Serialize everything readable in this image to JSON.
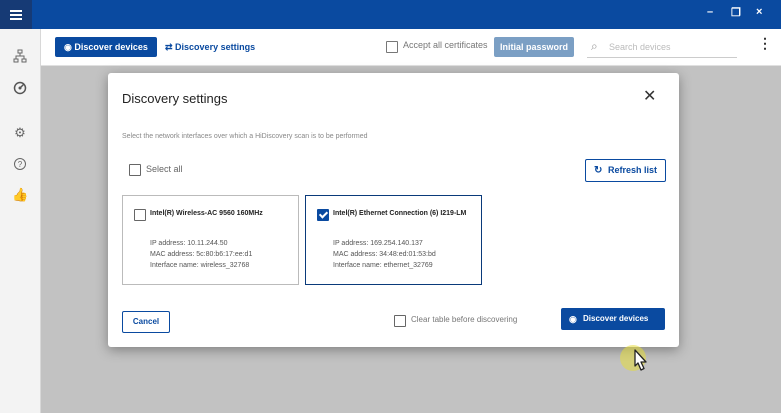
{
  "titlebar": {
    "minimize": "–",
    "restore": "❐",
    "close": "×"
  },
  "sidebar": {
    "items": [
      "network-icon",
      "discover-icon",
      "settings-icon",
      "help-icon",
      "thumbs-up-icon"
    ]
  },
  "toolbar": {
    "discover_label": "Discover devices",
    "settings_label": "Discovery settings",
    "accept_label": "Accept all certificates",
    "initial_password_label": "Initial password",
    "search_placeholder": "Search devices"
  },
  "dialog": {
    "title": "Discovery settings",
    "description": "Select the network interfaces over which a HiDiscovery scan is to be performed",
    "select_all_label": "Select all",
    "refresh_label": "Refresh list",
    "interfaces": [
      {
        "title": "Intel(R) Wireless-AC 9560 160MHz",
        "ip": "IP address: 10.11.244.50",
        "mac": "MAC address: 5c:80:b6:17:ee:d1",
        "name": "Interface name: wireless_32768",
        "selected": false
      },
      {
        "title": "Intel(R) Ethernet Connection (6) I219-LM",
        "ip": "IP address: 169.254.140.137",
        "mac": "MAC address: 34:48:ed:01:53:bd",
        "name": "Interface name: ethernet_32769",
        "selected": true
      }
    ],
    "cancel_label": "Cancel",
    "clear_label": "Clear table before discovering",
    "discover_label": "Discover devices"
  },
  "colors": {
    "brand": "#0a4aa0",
    "titlebar": "#0a4aa0"
  }
}
